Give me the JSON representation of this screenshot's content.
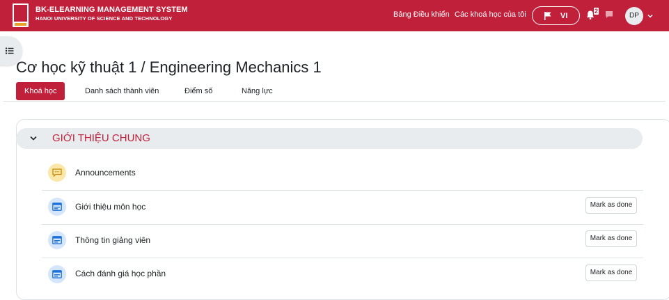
{
  "brand": {
    "title": "BK-ELEARNING MANAGEMENT SYSTEM",
    "subtitle": "HANOI UNIVERSITY OF SCIENCE AND TECHNOLOGY"
  },
  "navbar": {
    "links": [
      "Bảng Điều khiển",
      "Các khoá học của tôi"
    ],
    "language": "VI",
    "notification_count": "2",
    "user_initials": "DP"
  },
  "course": {
    "title": "Cơ học kỹ thuật 1 / Engineering Mechanics 1",
    "tabs": [
      "Khoá học",
      "Danh sách thành viên",
      "Điểm số",
      "Năng lực"
    ],
    "active_tab": "Khoá học"
  },
  "section": {
    "title": "GIỚI THIỆU CHUNG",
    "activities": [
      {
        "name": "Announcements",
        "icon": "forum-icon",
        "mark_label": ""
      },
      {
        "name": "Giới thiệu môn học",
        "icon": "page-icon",
        "mark_label": "Mark as done"
      },
      {
        "name": "Thông tin giảng viên",
        "icon": "page-icon",
        "mark_label": "Mark as done"
      },
      {
        "name": "Cách đánh giá học phần",
        "icon": "page-icon",
        "mark_label": "Mark as done"
      }
    ]
  },
  "colors": {
    "brand_red": "#c0203a",
    "forum_icon_bg": "#fbe7a8",
    "page_icon_bg": "#d5e6fb"
  }
}
